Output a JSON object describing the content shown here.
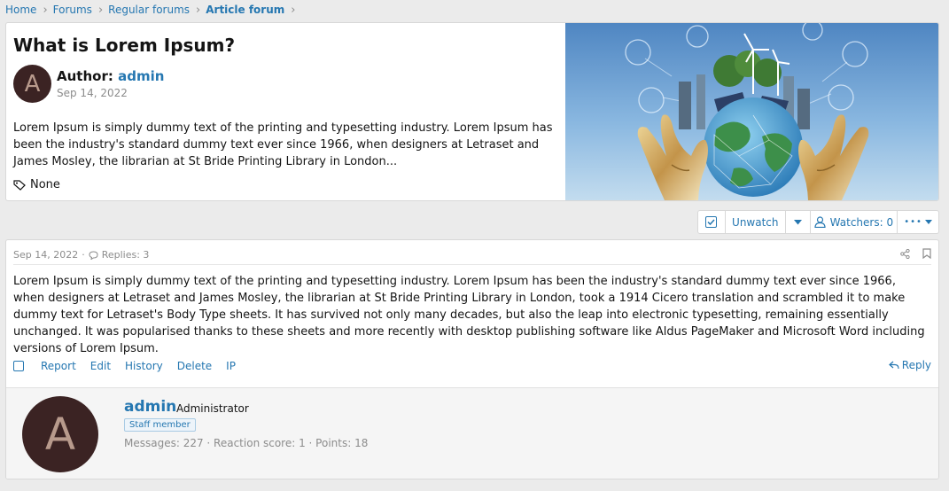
{
  "breadcrumb": [
    "Home",
    "Forums",
    "Regular forums",
    "Article forum"
  ],
  "article": {
    "title": "What is Lorem Ipsum?",
    "author_prefix": "Author:",
    "author": "admin",
    "avatar_letter": "A",
    "date": "Sep 14, 2022",
    "excerpt": "Lorem Ipsum is simply dummy text of the printing and typesetting industry. Lorem Ipsum has been the industry's standard dummy text ever since 1966, when designers at Letraset and James Mosley, the librarian at St Bride Printing Library in London...",
    "tags": "None"
  },
  "thread_actions": {
    "unwatch": "Unwatch",
    "watchers": "Watchers: 0",
    "more": "•••"
  },
  "post": {
    "date": "Sep 14, 2022",
    "sep": "·",
    "replies": "Replies: 3",
    "body": "Lorem Ipsum is simply dummy text of the printing and typesetting industry. Lorem Ipsum has been the industry's standard dummy text ever since 1966, when designers at Letraset and James Mosley, the librarian at St Bride Printing Library in London, took a 1914 Cicero translation and scrambled it to make dummy text for Letraset's Body Type sheets. It has survived not only many decades, but also the leap into electronic typesetting, remaining essentially unchanged. It was popularised thanks to these sheets and more recently with desktop publishing software like Aldus PageMaker and Microsoft Word including versions of Lorem Ipsum.",
    "actions": [
      "Report",
      "Edit",
      "History",
      "Delete",
      "IP"
    ],
    "reply": "Reply"
  },
  "user": {
    "avatar_letter": "A",
    "name": "admin",
    "title": "Administrator",
    "badge": "Staff member",
    "stats": "Messages: 227 · Reaction score: 1 · Points: 18"
  },
  "colors": {
    "link": "#2577b1",
    "avatar_bg": "#3b2323",
    "avatar_fg": "#b89a8c"
  }
}
